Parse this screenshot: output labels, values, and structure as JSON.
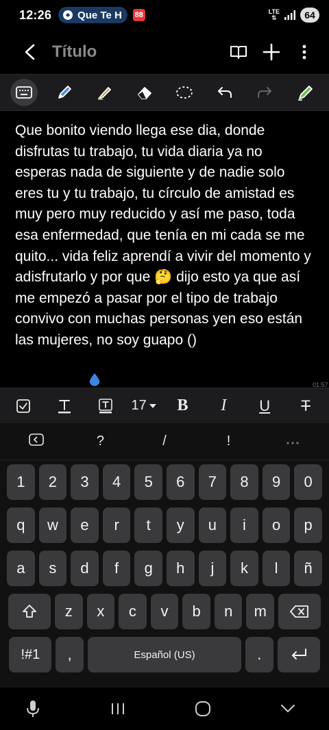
{
  "status_bar": {
    "time": "12:26",
    "pill_text": "Que Te H",
    "app_badge": "88",
    "network": "LTE",
    "battery": "64"
  },
  "header": {
    "title": "Título"
  },
  "note": {
    "text": "Que bonito viendo llega ese dia, donde disfrutas tu trabajo, tu vida diaria ya no esperas nada de siguiente y de nadie solo eres tu y tu trabajo, tu círculo de amistad es muy pero muy reducido y así me paso, toda esa enfermedad, que tenía en mi cada se me quito... vida feliz aprendí a vivir del momento y adisfrutarlo y por que 🤔 dijo esto ya que así me empezó a pasar por el tipo de trabajo convivo con muchas personas yen eso están las mujeres, no soy guapo ()",
    "side_time": "01:57"
  },
  "format_bar": {
    "font_size": "17",
    "bold": "B",
    "italic": "I",
    "underline": "U",
    "strike": "T"
  },
  "keyboard": {
    "suggestions": [
      "?",
      "/",
      "!"
    ],
    "numbers": [
      "1",
      "2",
      "3",
      "4",
      "5",
      "6",
      "7",
      "8",
      "9",
      "0"
    ],
    "row1": [
      "q",
      "w",
      "e",
      "r",
      "t",
      "y",
      "u",
      "i",
      "o",
      "p"
    ],
    "row2": [
      "a",
      "s",
      "d",
      "f",
      "g",
      "h",
      "j",
      "k",
      "l",
      "ñ"
    ],
    "row3": [
      "z",
      "x",
      "c",
      "v",
      "b",
      "n",
      "m"
    ],
    "symbols_key": "!#1",
    "comma_key": ",",
    "space_label": "Español (US)",
    "period_key": "."
  }
}
